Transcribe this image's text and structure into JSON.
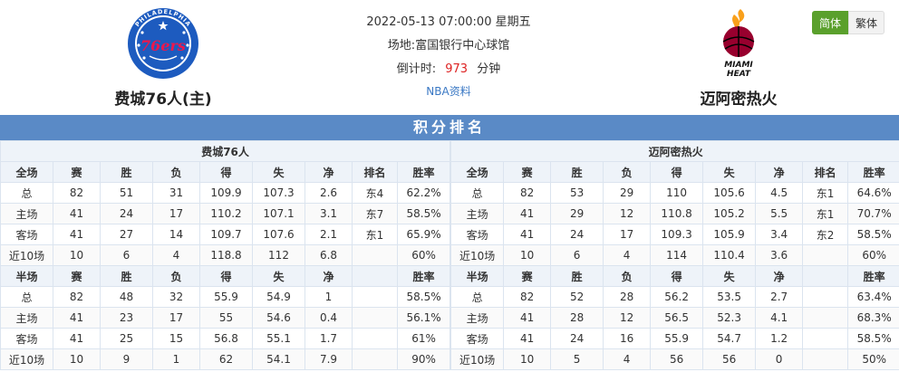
{
  "match": {
    "datetime": "2022-05-13 07:00:00 星期五",
    "venue_label": "场地:",
    "venue": "富国银行中心球馆",
    "countdown_label": "倒计时:",
    "countdown_value": "973",
    "countdown_unit": "分钟",
    "info_link": "NBA资料"
  },
  "home_team": {
    "name": "费城76人(主)",
    "logo_text": "76ers",
    "logo_ring_text": "PHILADELPHIA",
    "color": "#1d5bbf"
  },
  "away_team": {
    "name": "迈阿密热火",
    "logo_text_1": "MIAMI",
    "logo_text_2": "HEAT",
    "color": "#98002e"
  },
  "lang": {
    "simplified": "简体",
    "traditional": "繁体"
  },
  "section_title": "积分排名",
  "colors": {
    "accent": "#5a8ac6",
    "home_red": "#dd2222",
    "lang_green": "#5aa02c",
    "link_blue": "#3a78c4"
  },
  "standings": {
    "left_team": "费城76人",
    "right_team": "迈阿密热火",
    "full_headers": [
      "全场",
      "赛",
      "胜",
      "负",
      "得",
      "失",
      "净",
      "排名",
      "胜率"
    ],
    "half_headers": [
      "半场",
      "赛",
      "胜",
      "负",
      "得",
      "失",
      "净",
      "",
      "胜率"
    ],
    "left_full": [
      [
        "总",
        "82",
        "51",
        "31",
        "109.9",
        "107.3",
        "2.6",
        "东4",
        "62.2%"
      ],
      [
        "主场",
        "41",
        "24",
        "17",
        "110.2",
        "107.1",
        "3.1",
        "东7",
        "58.5%"
      ],
      [
        "客场",
        "41",
        "27",
        "14",
        "109.7",
        "107.6",
        "2.1",
        "东1",
        "65.9%"
      ],
      [
        "近10场",
        "10",
        "6",
        "4",
        "118.8",
        "112",
        "6.8",
        "",
        "60%"
      ]
    ],
    "left_half": [
      [
        "总",
        "82",
        "48",
        "32",
        "55.9",
        "54.9",
        "1",
        "",
        "58.5%"
      ],
      [
        "主场",
        "41",
        "23",
        "17",
        "55",
        "54.6",
        "0.4",
        "",
        "56.1%"
      ],
      [
        "客场",
        "41",
        "25",
        "15",
        "56.8",
        "55.1",
        "1.7",
        "",
        "61%"
      ],
      [
        "近10场",
        "10",
        "9",
        "1",
        "62",
        "54.1",
        "7.9",
        "",
        "90%"
      ]
    ],
    "right_full": [
      [
        "总",
        "82",
        "53",
        "29",
        "110",
        "105.6",
        "4.5",
        "东1",
        "64.6%"
      ],
      [
        "主场",
        "41",
        "29",
        "12",
        "110.8",
        "105.2",
        "5.5",
        "东1",
        "70.7%"
      ],
      [
        "客场",
        "41",
        "24",
        "17",
        "109.3",
        "105.9",
        "3.4",
        "东2",
        "58.5%"
      ],
      [
        "近10场",
        "10",
        "6",
        "4",
        "114",
        "110.4",
        "3.6",
        "",
        "60%"
      ]
    ],
    "right_half": [
      [
        "总",
        "82",
        "52",
        "28",
        "56.2",
        "53.5",
        "2.7",
        "",
        "63.4%"
      ],
      [
        "主场",
        "41",
        "28",
        "12",
        "56.5",
        "52.3",
        "4.1",
        "",
        "68.3%"
      ],
      [
        "客场",
        "41",
        "24",
        "16",
        "55.9",
        "54.7",
        "1.2",
        "",
        "58.5%"
      ],
      [
        "近10场",
        "10",
        "5",
        "4",
        "56",
        "56",
        "0",
        "",
        "50%"
      ]
    ]
  }
}
